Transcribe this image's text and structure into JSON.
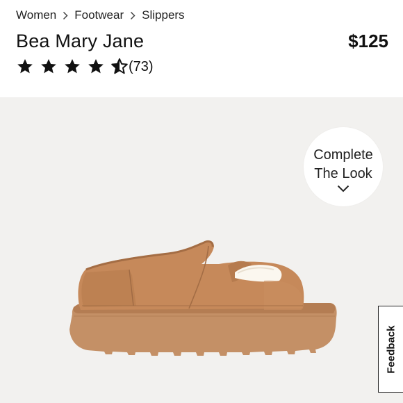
{
  "breadcrumb": {
    "items": [
      {
        "label": "Women"
      },
      {
        "label": "Footwear"
      },
      {
        "label": "Slippers"
      }
    ],
    "separator_icon": "chevron-right-icon"
  },
  "product": {
    "title": "Bea Mary Jane",
    "price": "$125",
    "rating": {
      "value": 4.5,
      "max": 5,
      "review_count": "(73)",
      "star_icons": [
        "star-full-icon",
        "star-full-icon",
        "star-full-icon",
        "star-full-icon",
        "star-half-icon"
      ]
    }
  },
  "hero": {
    "background_color": "#f2f1ef",
    "image_icon": "slipper-product-image",
    "product_color": "#c98e5f"
  },
  "complete_the_look": {
    "line1": "Complete",
    "line2": "The Look",
    "icon": "chevron-down-icon"
  },
  "feedback": {
    "label": "Feedback"
  }
}
